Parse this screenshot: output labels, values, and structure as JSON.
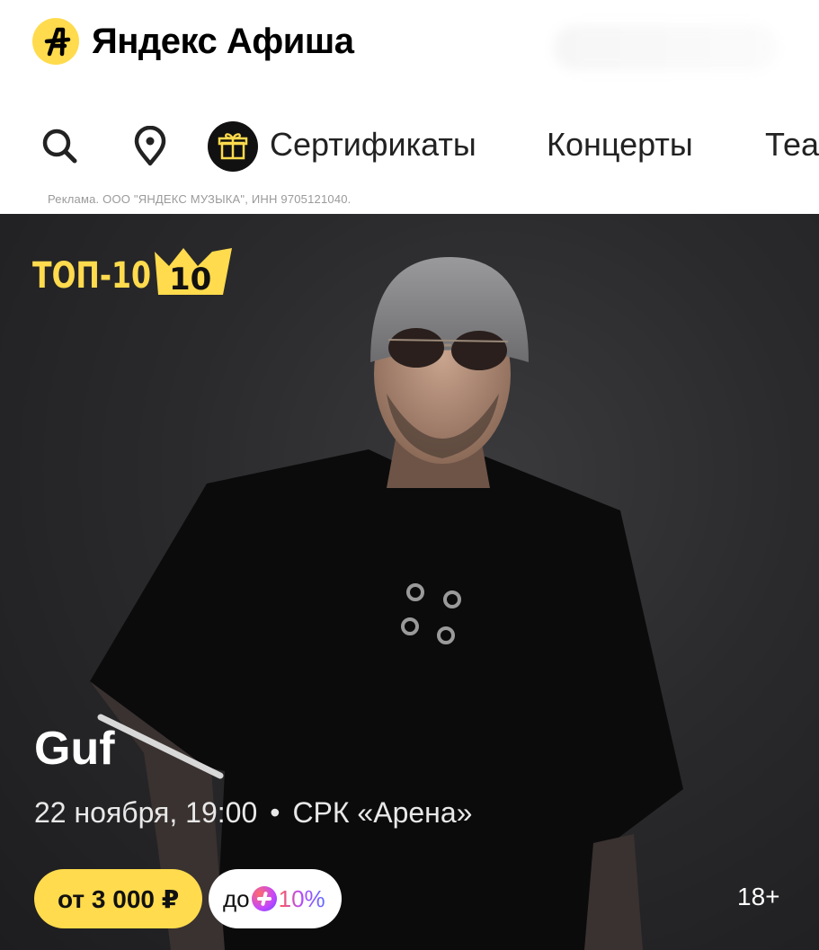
{
  "header": {
    "logo_text": "Яндекс Афиша",
    "logo_icon": "afisha-logo-icon"
  },
  "nav": {
    "search_icon": "search-icon",
    "location_icon": "location-pin-icon",
    "gift_icon": "gift-icon",
    "items": [
      {
        "label": "Сертификаты"
      },
      {
        "label": "Концерты"
      },
      {
        "label": "Теа"
      }
    ]
  },
  "ad_note": "Реклама. ООО \"ЯНДЕКС МУЗЫКА\", ИНН 9705121040.",
  "banner": {
    "badge": "ТОП-10",
    "title": "Guf",
    "date": "22 ноября, 19:00",
    "separator": "•",
    "venue": "СРК «Арена»",
    "price_label": "от 3 000 ₽",
    "plus_prefix": "до",
    "plus_value": "10%",
    "age_rating": "18+"
  },
  "colors": {
    "accent_yellow": "#ffdb4d",
    "banner_bg": "#2a2a2c"
  }
}
